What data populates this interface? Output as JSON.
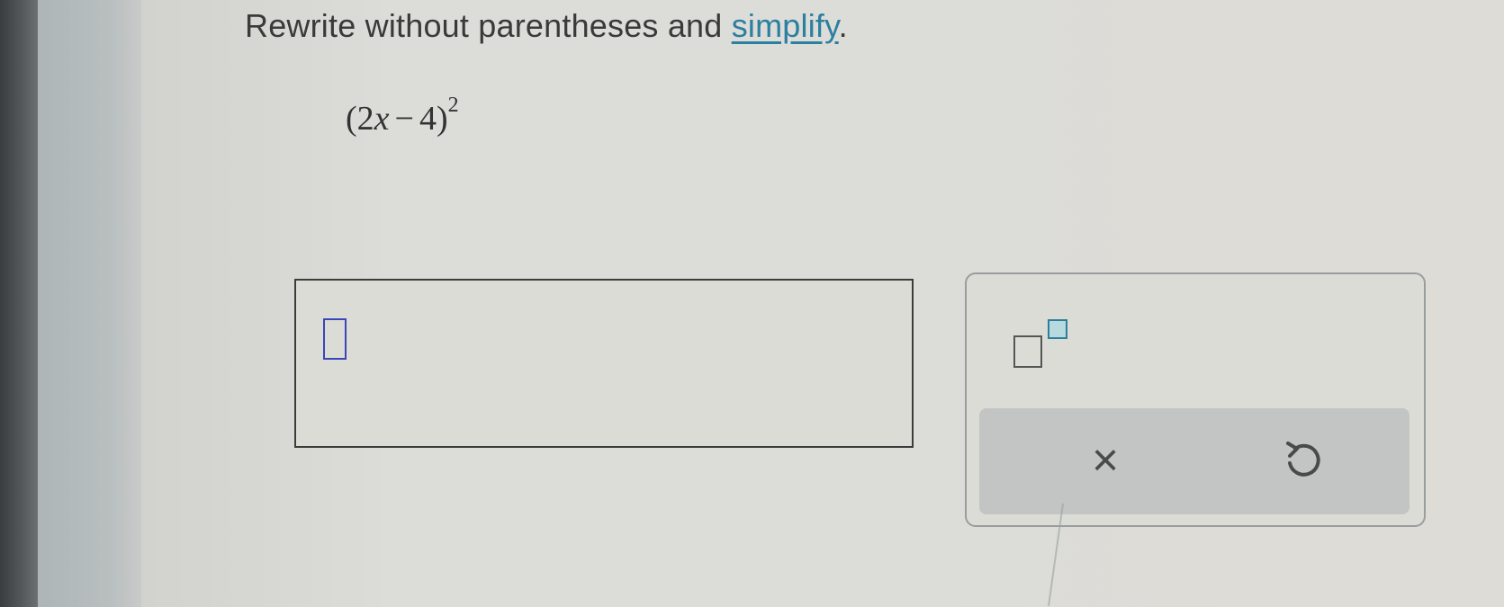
{
  "problem": {
    "instruction_text": "Rewrite without parentheses and ",
    "instruction_link": "simplify",
    "instruction_end": ".",
    "expression": {
      "open_paren": "(",
      "coefficient": "2",
      "variable": "x",
      "minus": "−",
      "constant": "4",
      "close_paren": ")",
      "exponent": "2"
    }
  },
  "palette": {
    "exponent_icon": "superscript-template-icon",
    "clear_symbol": "×",
    "undo_icon": "undo-icon"
  },
  "colors": {
    "link": "#2b7fa0",
    "cursor": "#3a46b8",
    "exponent_slot": "#b7d9e0"
  }
}
